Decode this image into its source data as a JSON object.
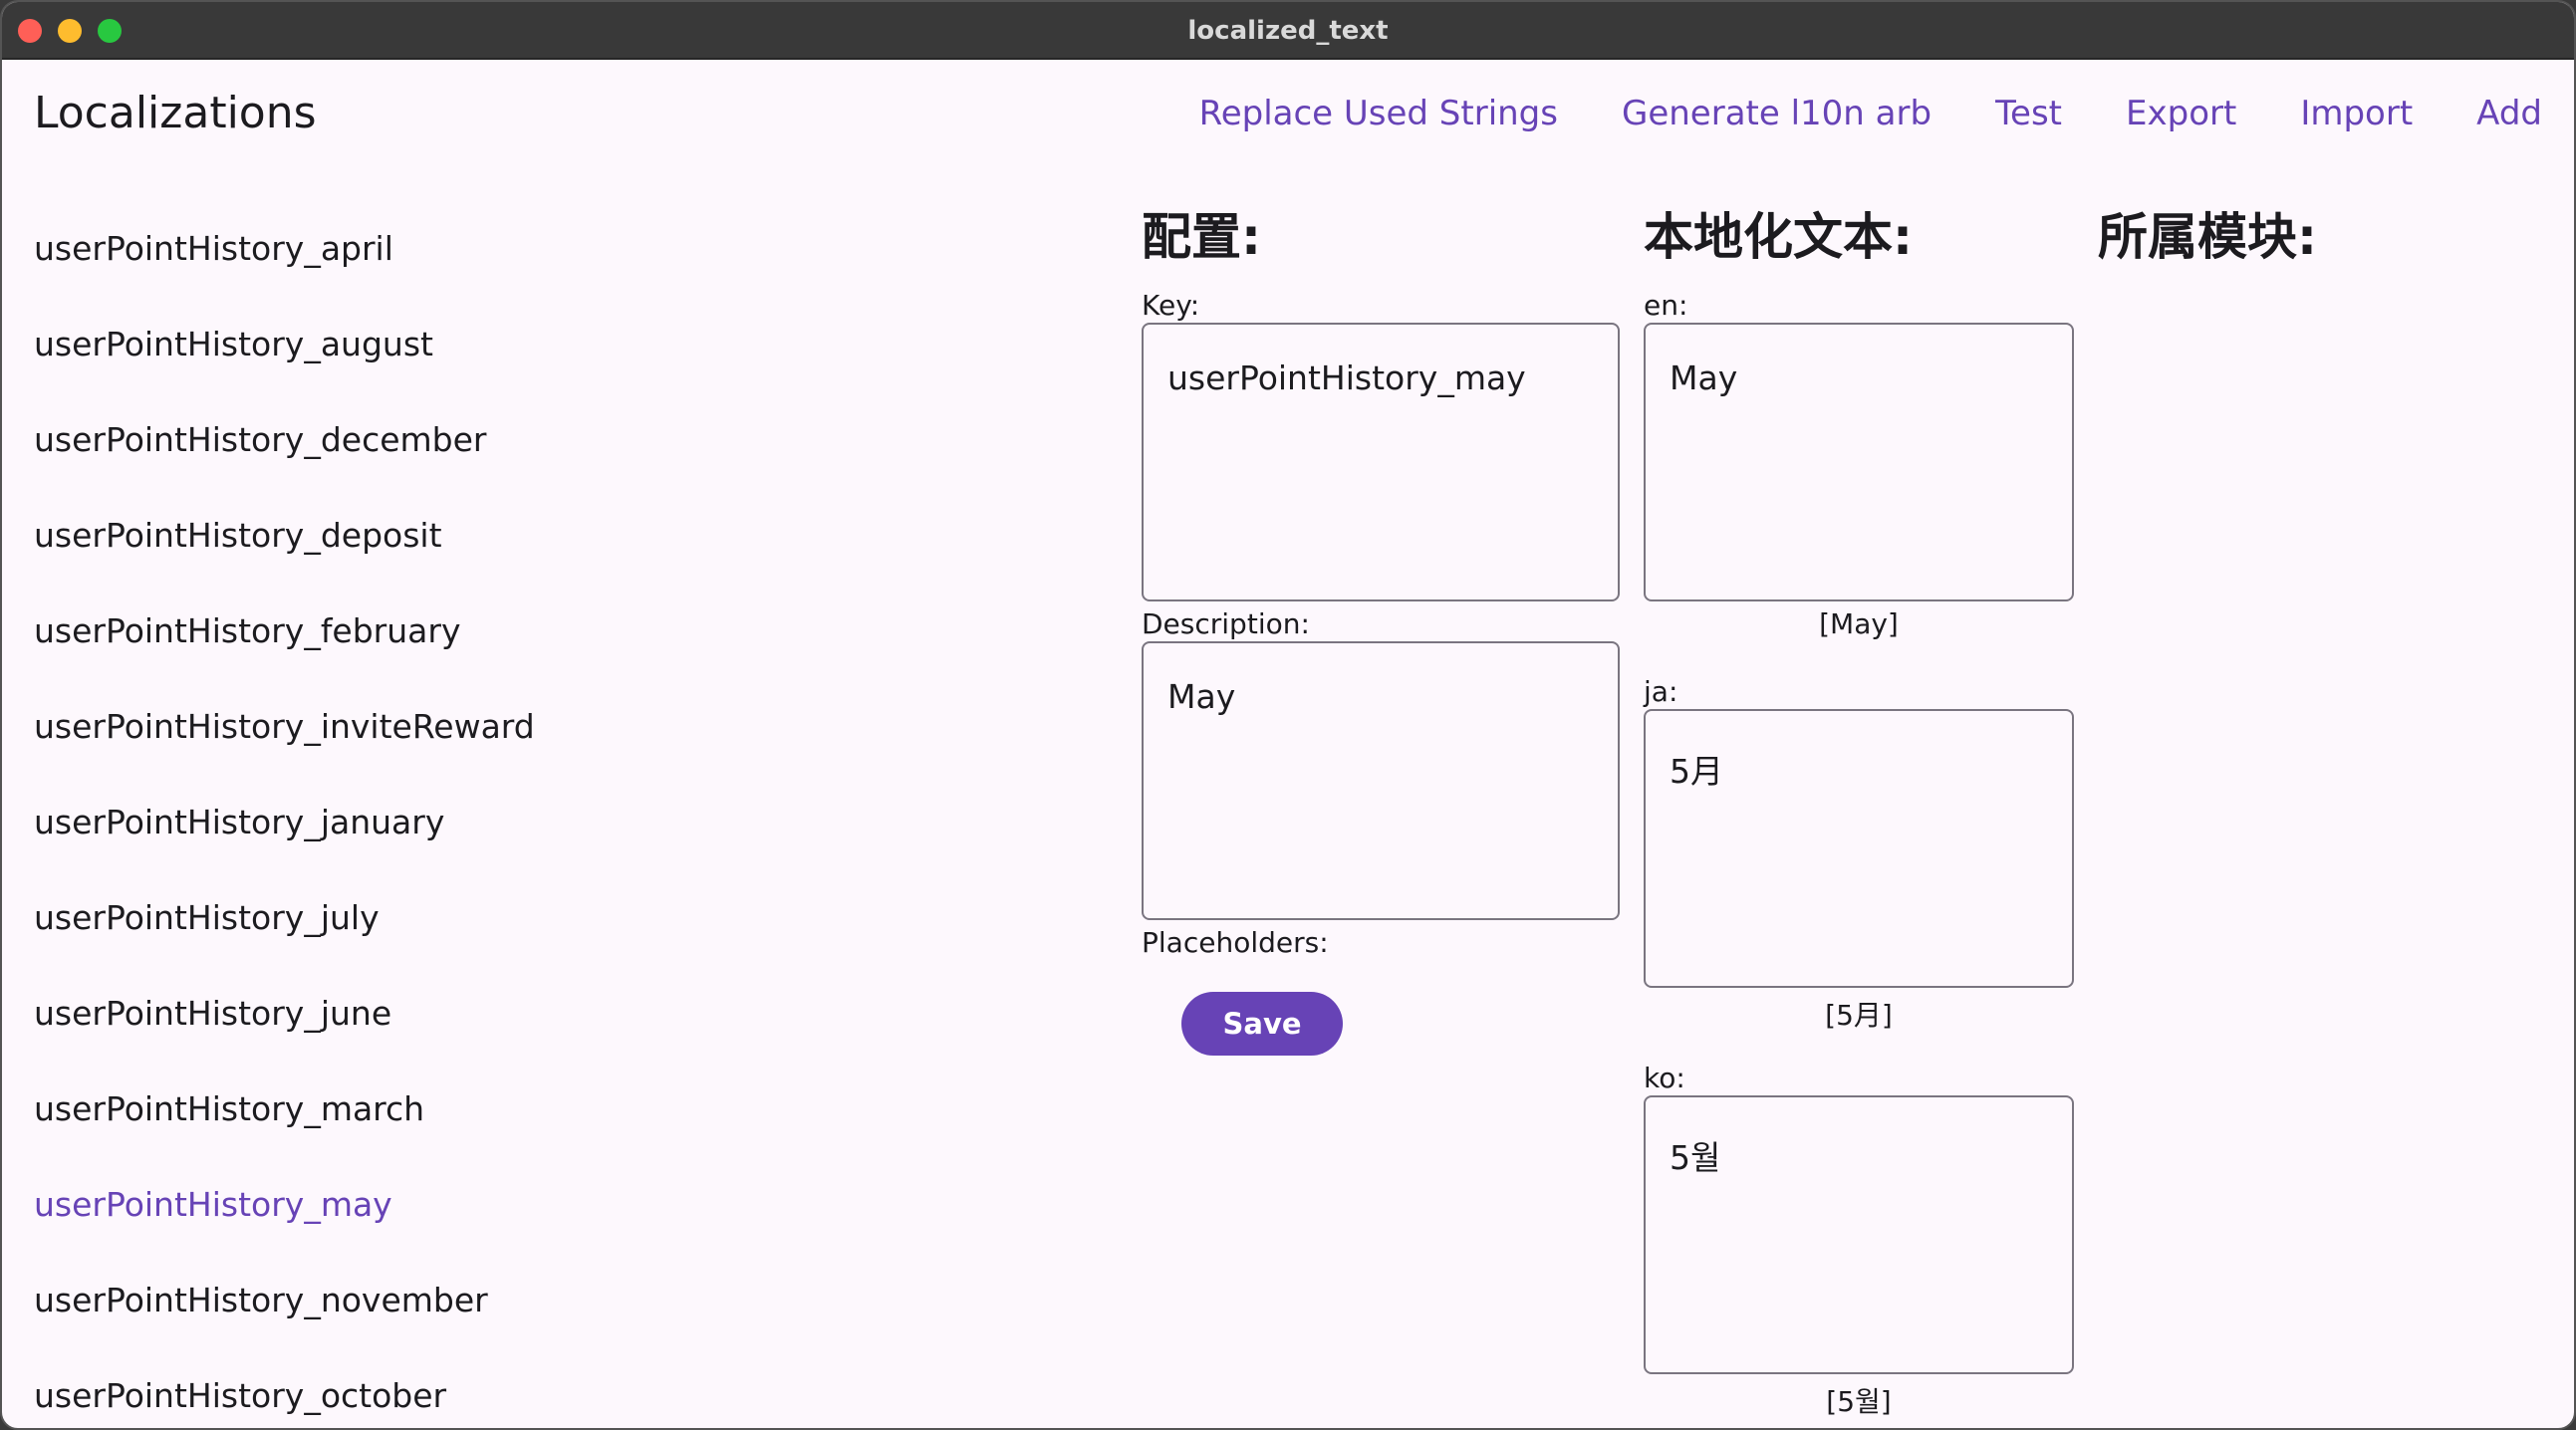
{
  "window": {
    "title": "localized_text"
  },
  "appbar": {
    "title": "Localizations",
    "actions": [
      "Replace Used Strings",
      "Generate l10n arb",
      "Test",
      "Export",
      "Import",
      "Add"
    ]
  },
  "keys": [
    "userPointHistory_april",
    "userPointHistory_august",
    "userPointHistory_december",
    "userPointHistory_deposit",
    "userPointHistory_february",
    "userPointHistory_inviteReward",
    "userPointHistory_january",
    "userPointHistory_july",
    "userPointHistory_june",
    "userPointHistory_march",
    "userPointHistory_may",
    "userPointHistory_november",
    "userPointHistory_october"
  ],
  "selected_key": "userPointHistory_may",
  "config": {
    "heading": "配置:",
    "key_label": "Key:",
    "key_value": "userPointHistory_may",
    "description_label": "Description:",
    "description_value": "May",
    "placeholders_label": "Placeholders:",
    "save_label": "Save"
  },
  "localized": {
    "heading": "本地化文本:",
    "locales": [
      {
        "label": "en:",
        "value": "May",
        "preview": "[May]"
      },
      {
        "label": "ja:",
        "value": "5月",
        "preview": "[5月]"
      },
      {
        "label": "ko:",
        "value": "5월",
        "preview": "[5월]"
      }
    ]
  },
  "module": {
    "heading": "所属模块:"
  },
  "colors": {
    "accent": "#6743b6",
    "background": "#fdf8fd",
    "titlebar": "#393939"
  }
}
